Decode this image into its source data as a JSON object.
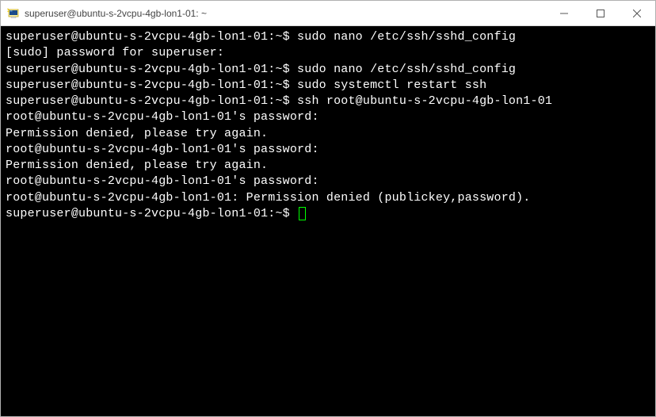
{
  "window": {
    "title": "superuser@ubuntu-s-2vcpu-4gb-lon1-01: ~"
  },
  "controls": {
    "minimize": "─",
    "maximize": "☐",
    "close": "✕"
  },
  "terminal": {
    "lines": [
      "superuser@ubuntu-s-2vcpu-4gb-lon1-01:~$ sudo nano /etc/ssh/sshd_config",
      "[sudo] password for superuser:",
      "superuser@ubuntu-s-2vcpu-4gb-lon1-01:~$ sudo nano /etc/ssh/sshd_config",
      "superuser@ubuntu-s-2vcpu-4gb-lon1-01:~$ sudo systemctl restart ssh",
      "superuser@ubuntu-s-2vcpu-4gb-lon1-01:~$ ssh root@ubuntu-s-2vcpu-4gb-lon1-01",
      "root@ubuntu-s-2vcpu-4gb-lon1-01's password:",
      "Permission denied, please try again.",
      "root@ubuntu-s-2vcpu-4gb-lon1-01's password:",
      "Permission denied, please try again.",
      "root@ubuntu-s-2vcpu-4gb-lon1-01's password:",
      "root@ubuntu-s-2vcpu-4gb-lon1-01: Permission denied (publickey,password)."
    ],
    "prompt": "superuser@ubuntu-s-2vcpu-4gb-lon1-01:~$ "
  }
}
